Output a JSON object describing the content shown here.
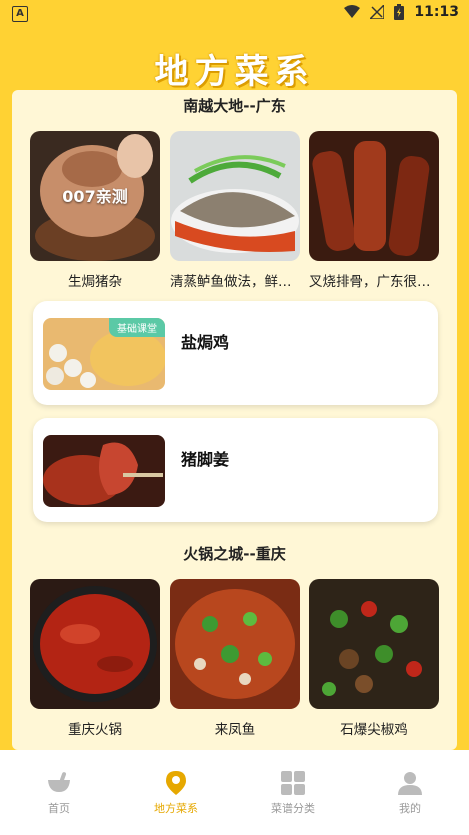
{
  "status_bar": {
    "app_letter": "A",
    "time": "11:13"
  },
  "header": {
    "title": "地方菜系"
  },
  "sections": [
    {
      "title": "南越大地--广东",
      "cards": [
        {
          "label": "生焗猪杂",
          "overlay": "007亲测"
        },
        {
          "label": "清蒸鲈鱼做法，鲜嫩..."
        },
        {
          "label": "叉烧排骨，广东很常..."
        }
      ],
      "rows": [
        {
          "title": "盐焗鸡",
          "badge": "基础课堂"
        },
        {
          "title": "猪脚姜"
        }
      ]
    },
    {
      "title": "火锅之城--重庆",
      "cards": [
        {
          "label": "重庆火锅"
        },
        {
          "label": "来凤鱼"
        },
        {
          "label": "石爆尖椒鸡"
        }
      ]
    }
  ],
  "tabbar": {
    "items": [
      {
        "label": "首页",
        "icon": "mortar-icon"
      },
      {
        "label": "地方菜系",
        "icon": "location-pin-icon",
        "active": true
      },
      {
        "label": "菜谱分类",
        "icon": "grid-icon"
      },
      {
        "label": "我的",
        "icon": "person-icon"
      }
    ]
  },
  "colors": {
    "background": "#FFD233",
    "panel": "#FFF7D6",
    "accent": "#E6A800",
    "badge": "#5BC9A6"
  }
}
